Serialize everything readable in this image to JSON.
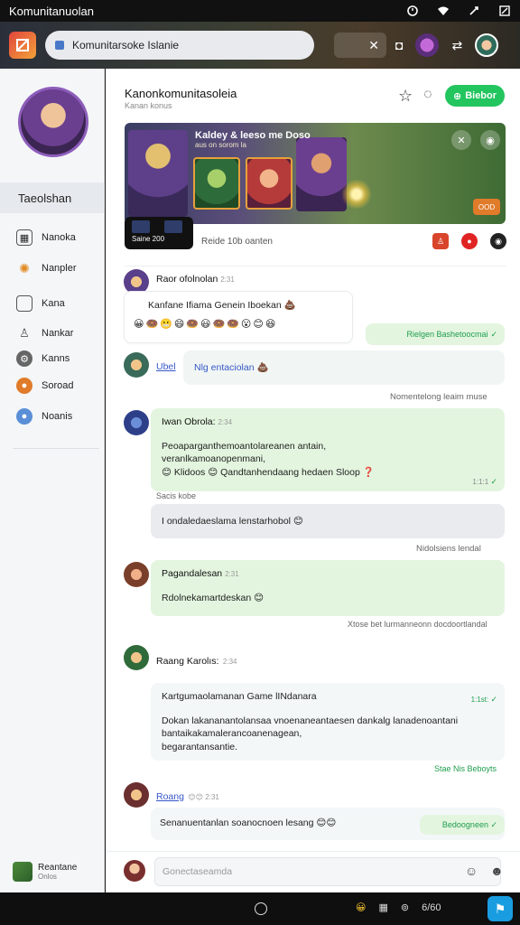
{
  "status_bar": {
    "title": "Komunitanuolan"
  },
  "app_bar": {
    "url_text": "Komunitarsoke Islanie",
    "close_glyph": "✕",
    "camera_glyph": "◘",
    "sharing_glyph": "⇄"
  },
  "sidebar": {
    "heading": "Taeolshan",
    "items": [
      {
        "label": "Nanoka",
        "icon": "calendar-icon"
      },
      {
        "label": "Nanpler",
        "icon": "sun-icon"
      },
      {
        "label": "Kana",
        "icon": "square-icon"
      },
      {
        "label": "Nankar",
        "icon": "person-icon"
      },
      {
        "label": "Kanns",
        "icon": "settings-icon"
      },
      {
        "label": "Soroad",
        "icon": "orange-circle-icon"
      },
      {
        "label": "Noanis",
        "icon": "blue-circle-icon"
      }
    ],
    "user": {
      "name": "Reantane",
      "status": "Onlos"
    }
  },
  "channel": {
    "title": "Kanonkomunitasoleia",
    "subtitle": "Kanan konus",
    "join_label": "Biebor",
    "banner": {
      "title": "Kaldey & leeso me Doso",
      "subtitle": "aus on sorom la"
    },
    "banner_badge": "OOD",
    "media_chip_text": "Saine 200",
    "media_text": "Reide 10b oanten"
  },
  "messages": [
    {
      "name": "Raor ofolnolan",
      "time": "2:31",
      "text": "Kanfane Ifiama Genein Iboekan 💩",
      "emojis": "😀🍩😬😄🍩😃🍩🍩😮😊😆"
    },
    {
      "kind": "note",
      "text": "Rielgen Bashetoocmai",
      "tick": "✓"
    },
    {
      "name": "Ubel",
      "text": "Nlg entaciolan 💩"
    },
    {
      "kind": "note",
      "text": "Nomentelong leaim muse"
    },
    {
      "name": "Iwan Obrola:",
      "time": "2:34",
      "lines": [
        "Peoaparganthemoantolareanen antain,",
        "veranlkamoanopenmani,",
        "😊 Klidoos 😊 Qandtanhendaang hedaen Sloop ❓"
      ],
      "meta": "1:1:1",
      "tick": "✓"
    },
    {
      "kind": "label",
      "text": "Sacis kobe"
    },
    {
      "kind": "grey",
      "text": "I ondaledaeslama lenstarhobol 😊"
    },
    {
      "kind": "note",
      "text": "Nidolsiens lendal"
    },
    {
      "name": "Pagandalesan",
      "time": "2:31",
      "text": "Rdolnekamartdeskan 😊"
    },
    {
      "kind": "note",
      "text": "Xtose bet lurmanneonn docdoortlandal"
    },
    {
      "name": "Raang Karolıs:",
      "time": "2:34",
      "heading": "Kartgumaolamanan Game lINdanara",
      "lines": [
        "Dokan lakananantolansaa vnoenaneantaesen dankalg lanadenoantani",
        "bantaikakamalerancoanenagean,",
        "begarantansantie."
      ],
      "meta": "1:1st:",
      "tick": "✓"
    },
    {
      "kind": "note",
      "text": "Stae Nis Beboyts"
    },
    {
      "name": "Roang",
      "time": "😊😊 2:31",
      "text": "Senanuentanlan soanocnoen lesang 😊😊"
    },
    {
      "kind": "note",
      "text": "Bedoogneen ✓"
    }
  ],
  "composer": {
    "placeholder": "Gonectaseamda"
  },
  "nav": {
    "tray_label": "6/60",
    "tray_icons": [
      "😀",
      "▦",
      "⊚"
    ],
    "flag_glyph": "⚑"
  },
  "colors": {
    "accent_green": "#22c55e",
    "bubble_green": "#e3f5df",
    "nav_blue": "#1a9de0"
  }
}
